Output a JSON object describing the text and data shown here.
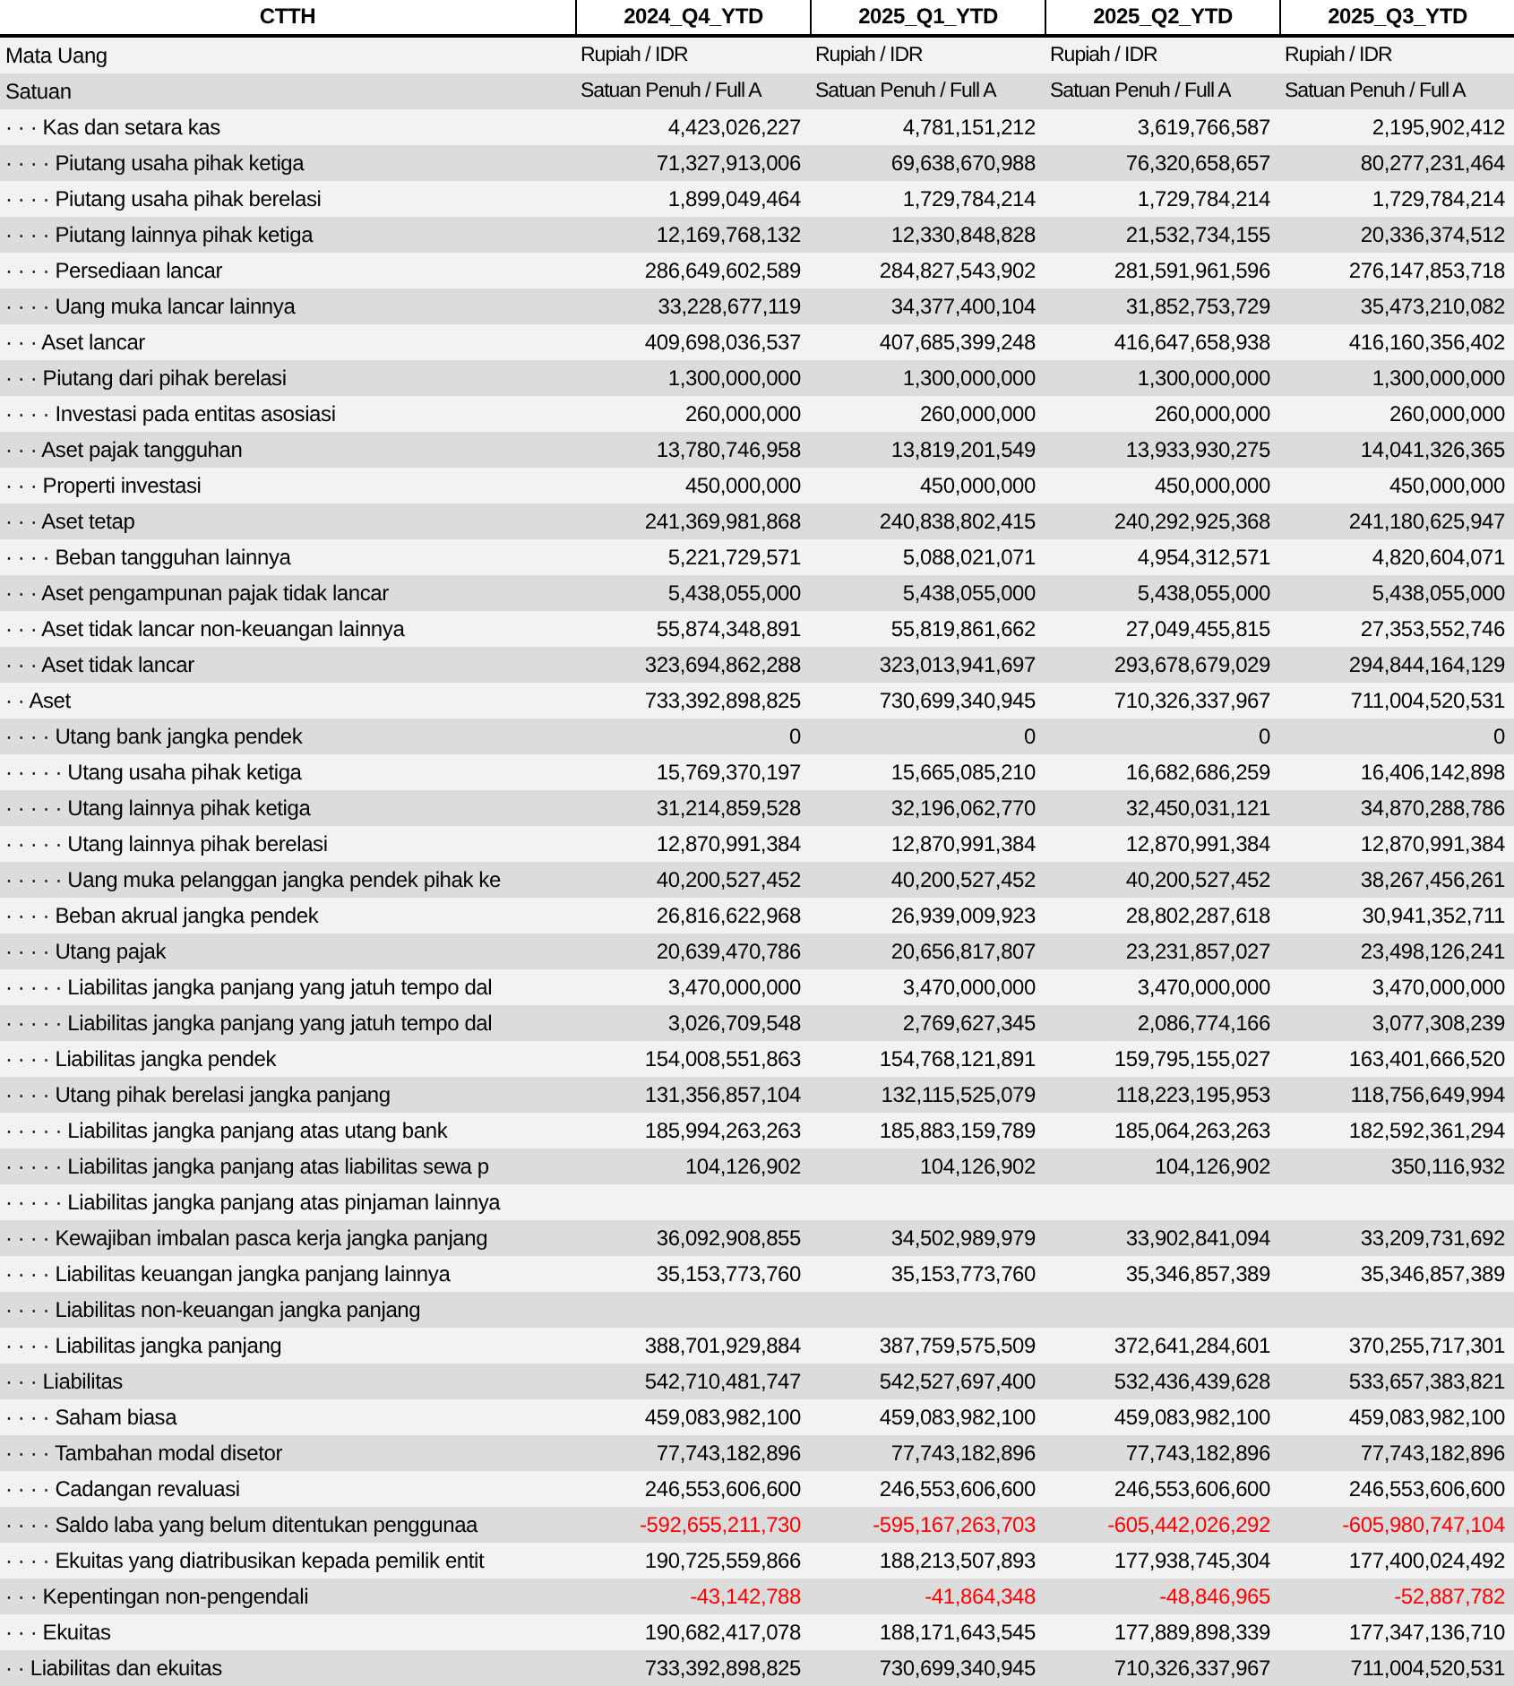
{
  "table": {
    "columns": [
      "CTTH",
      "2024_Q4_YTD",
      "2025_Q1_YTD",
      "2025_Q2_YTD",
      "2025_Q3_YTD"
    ],
    "rows": [
      {
        "kind": "meta",
        "label": "Mata Uang",
        "negative": false,
        "values": [
          "Rupiah / IDR",
          "Rupiah / IDR",
          "Rupiah / IDR",
          "Rupiah / IDR"
        ]
      },
      {
        "kind": "meta",
        "label": "Satuan",
        "negative": false,
        "values": [
          "Satuan Penuh / Full A",
          "Satuan Penuh / Full A",
          "Satuan Penuh / Full A",
          "Satuan Penuh / Full A"
        ]
      },
      {
        "kind": "amount",
        "label": "· · · Kas dan setara kas",
        "negative": false,
        "values": [
          "4,423,026,227",
          "4,781,151,212",
          "3,619,766,587",
          "2,195,902,412"
        ]
      },
      {
        "kind": "amount",
        "label": "· · · · Piutang usaha pihak ketiga",
        "negative": false,
        "values": [
          "71,327,913,006",
          "69,638,670,988",
          "76,320,658,657",
          "80,277,231,464"
        ]
      },
      {
        "kind": "amount",
        "label": "· · · · Piutang usaha pihak berelasi",
        "negative": false,
        "values": [
          "1,899,049,464",
          "1,729,784,214",
          "1,729,784,214",
          "1,729,784,214"
        ]
      },
      {
        "kind": "amount",
        "label": "· · · · Piutang lainnya pihak ketiga",
        "negative": false,
        "values": [
          "12,169,768,132",
          "12,330,848,828",
          "21,532,734,155",
          "20,336,374,512"
        ]
      },
      {
        "kind": "amount",
        "label": "· · · · Persediaan lancar",
        "negative": false,
        "values": [
          "286,649,602,589",
          "284,827,543,902",
          "281,591,961,596",
          "276,147,853,718"
        ]
      },
      {
        "kind": "amount",
        "label": "· · · · Uang muka lancar lainnya",
        "negative": false,
        "values": [
          "33,228,677,119",
          "34,377,400,104",
          "31,852,753,729",
          "35,473,210,082"
        ]
      },
      {
        "kind": "amount",
        "label": "· · · Aset lancar",
        "negative": false,
        "values": [
          "409,698,036,537",
          "407,685,399,248",
          "416,647,658,938",
          "416,160,356,402"
        ]
      },
      {
        "kind": "amount",
        "label": "· · · Piutang dari pihak berelasi",
        "negative": false,
        "values": [
          "1,300,000,000",
          "1,300,000,000",
          "1,300,000,000",
          "1,300,000,000"
        ]
      },
      {
        "kind": "amount",
        "label": "· · · · Investasi pada entitas asosiasi",
        "negative": false,
        "values": [
          "260,000,000",
          "260,000,000",
          "260,000,000",
          "260,000,000"
        ]
      },
      {
        "kind": "amount",
        "label": "· · · Aset pajak tangguhan",
        "negative": false,
        "values": [
          "13,780,746,958",
          "13,819,201,549",
          "13,933,930,275",
          "14,041,326,365"
        ]
      },
      {
        "kind": "amount",
        "label": "· · · Properti investasi",
        "negative": false,
        "values": [
          "450,000,000",
          "450,000,000",
          "450,000,000",
          "450,000,000"
        ]
      },
      {
        "kind": "amount",
        "label": "· · · Aset tetap",
        "negative": false,
        "values": [
          "241,369,981,868",
          "240,838,802,415",
          "240,292,925,368",
          "241,180,625,947"
        ]
      },
      {
        "kind": "amount",
        "label": "· · · · Beban tangguhan lainnya",
        "negative": false,
        "values": [
          "5,221,729,571",
          "5,088,021,071",
          "4,954,312,571",
          "4,820,604,071"
        ]
      },
      {
        "kind": "amount",
        "label": "· · · Aset pengampunan pajak tidak lancar",
        "negative": false,
        "values": [
          "5,438,055,000",
          "5,438,055,000",
          "5,438,055,000",
          "5,438,055,000"
        ]
      },
      {
        "kind": "amount",
        "label": "· · · Aset tidak lancar non-keuangan lainnya",
        "negative": false,
        "values": [
          "55,874,348,891",
          "55,819,861,662",
          "27,049,455,815",
          "27,353,552,746"
        ]
      },
      {
        "kind": "amount",
        "label": "· · · Aset tidak lancar",
        "negative": false,
        "values": [
          "323,694,862,288",
          "323,013,941,697",
          "293,678,679,029",
          "294,844,164,129"
        ]
      },
      {
        "kind": "amount",
        "label": "· · Aset",
        "negative": false,
        "values": [
          "733,392,898,825",
          "730,699,340,945",
          "710,326,337,967",
          "711,004,520,531"
        ]
      },
      {
        "kind": "amount",
        "label": "· · · · Utang bank jangka pendek",
        "negative": false,
        "values": [
          "0",
          "0",
          "0",
          "0"
        ]
      },
      {
        "kind": "amount",
        "label": "· · · · · Utang usaha pihak ketiga",
        "negative": false,
        "values": [
          "15,769,370,197",
          "15,665,085,210",
          "16,682,686,259",
          "16,406,142,898"
        ]
      },
      {
        "kind": "amount",
        "label": "· · · · · Utang lainnya pihak ketiga",
        "negative": false,
        "values": [
          "31,214,859,528",
          "32,196,062,770",
          "32,450,031,121",
          "34,870,288,786"
        ]
      },
      {
        "kind": "amount",
        "label": "· · · · · Utang lainnya pihak berelasi",
        "negative": false,
        "values": [
          "12,870,991,384",
          "12,870,991,384",
          "12,870,991,384",
          "12,870,991,384"
        ]
      },
      {
        "kind": "amount",
        "label": "· · · · · Uang muka pelanggan jangka pendek pihak ke",
        "negative": false,
        "values": [
          "40,200,527,452",
          "40,200,527,452",
          "40,200,527,452",
          "38,267,456,261"
        ]
      },
      {
        "kind": "amount",
        "label": "· · · · Beban akrual jangka pendek",
        "negative": false,
        "values": [
          "26,816,622,968",
          "26,939,009,923",
          "28,802,287,618",
          "30,941,352,711"
        ]
      },
      {
        "kind": "amount",
        "label": "· · · · Utang pajak",
        "negative": false,
        "values": [
          "20,639,470,786",
          "20,656,817,807",
          "23,231,857,027",
          "23,498,126,241"
        ]
      },
      {
        "kind": "amount",
        "label": "· · · · · Liabilitas jangka panjang yang jatuh tempo dal",
        "negative": false,
        "values": [
          "3,470,000,000",
          "3,470,000,000",
          "3,470,000,000",
          "3,470,000,000"
        ]
      },
      {
        "kind": "amount",
        "label": "· · · · · Liabilitas jangka panjang yang jatuh tempo dal",
        "negative": false,
        "values": [
          "3,026,709,548",
          "2,769,627,345",
          "2,086,774,166",
          "3,077,308,239"
        ]
      },
      {
        "kind": "amount",
        "label": "· · · · Liabilitas jangka pendek",
        "negative": false,
        "values": [
          "154,008,551,863",
          "154,768,121,891",
          "159,795,155,027",
          "163,401,666,520"
        ]
      },
      {
        "kind": "amount",
        "label": "· · · · Utang pihak berelasi jangka panjang",
        "negative": false,
        "values": [
          "131,356,857,104",
          "132,115,525,079",
          "118,223,195,953",
          "118,756,649,994"
        ]
      },
      {
        "kind": "amount",
        "label": "· · · · · Liabilitas jangka panjang atas utang bank",
        "negative": false,
        "values": [
          "185,994,263,263",
          "185,883,159,789",
          "185,064,263,263",
          "182,592,361,294"
        ]
      },
      {
        "kind": "amount",
        "label": "· · · · · Liabilitas jangka panjang atas liabilitas sewa p",
        "negative": false,
        "values": [
          "104,126,902",
          "104,126,902",
          "104,126,902",
          "350,116,932"
        ]
      },
      {
        "kind": "section",
        "label": "· · · · · Liabilitas jangka panjang atas pinjaman lainnya"
      },
      {
        "kind": "amount",
        "label": "· · · · Kewajiban imbalan pasca kerja jangka panjang",
        "negative": false,
        "values": [
          "36,092,908,855",
          "34,502,989,979",
          "33,902,841,094",
          "33,209,731,692"
        ]
      },
      {
        "kind": "amount",
        "label": "· · · · Liabilitas keuangan jangka panjang lainnya",
        "negative": false,
        "values": [
          "35,153,773,760",
          "35,153,773,760",
          "35,346,857,389",
          "35,346,857,389"
        ]
      },
      {
        "kind": "section",
        "label": "· · · · Liabilitas non-keuangan jangka panjang"
      },
      {
        "kind": "amount",
        "label": "· · · · Liabilitas jangka panjang",
        "negative": false,
        "values": [
          "388,701,929,884",
          "387,759,575,509",
          "372,641,284,601",
          "370,255,717,301"
        ]
      },
      {
        "kind": "amount",
        "label": "· · · Liabilitas",
        "negative": false,
        "values": [
          "542,710,481,747",
          "542,527,697,400",
          "532,436,439,628",
          "533,657,383,821"
        ]
      },
      {
        "kind": "amount",
        "label": "· · · · Saham biasa",
        "negative": false,
        "values": [
          "459,083,982,100",
          "459,083,982,100",
          "459,083,982,100",
          "459,083,982,100"
        ]
      },
      {
        "kind": "amount",
        "label": "· · · · Tambahan modal disetor",
        "negative": false,
        "values": [
          "77,743,182,896",
          "77,743,182,896",
          "77,743,182,896",
          "77,743,182,896"
        ]
      },
      {
        "kind": "amount",
        "label": "· · · · Cadangan revaluasi",
        "negative": false,
        "values": [
          "246,553,606,600",
          "246,553,606,600",
          "246,553,606,600",
          "246,553,606,600"
        ]
      },
      {
        "kind": "amount",
        "label": "· · · · Saldo laba yang belum ditentukan penggunaa",
        "negative": true,
        "values": [
          "-592,655,211,730",
          "-595,167,263,703",
          "-605,442,026,292",
          "-605,980,747,104"
        ]
      },
      {
        "kind": "amount",
        "label": "· · · · Ekuitas yang diatribusikan kepada pemilik entit",
        "negative": false,
        "values": [
          "190,725,559,866",
          "188,213,507,893",
          "177,938,745,304",
          "177,400,024,492"
        ]
      },
      {
        "kind": "amount",
        "label": "· · · Kepentingan non-pengendali",
        "negative": true,
        "values": [
          "-43,142,788",
          "-41,864,348",
          "-48,846,965",
          "-52,887,782"
        ]
      },
      {
        "kind": "amount",
        "label": "· · · Ekuitas",
        "negative": false,
        "values": [
          "190,682,417,078",
          "188,171,643,545",
          "177,889,898,339",
          "177,347,136,710"
        ]
      },
      {
        "kind": "amount",
        "label": "· · Liabilitas dan ekuitas",
        "negative": false,
        "values": [
          "733,392,898,825",
          "730,699,340,945",
          "710,326,337,967",
          "711,004,520,531"
        ]
      }
    ]
  }
}
